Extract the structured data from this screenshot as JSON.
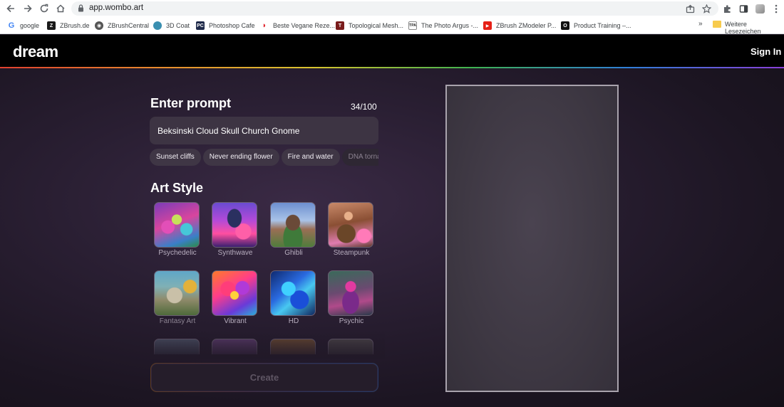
{
  "browser": {
    "url": "app.wombo.art",
    "bookmarks": [
      {
        "label": "google",
        "icon": "google-icon"
      },
      {
        "label": "ZBrush.de",
        "icon": "zbrush-de-icon"
      },
      {
        "label": "ZBrushCentral",
        "icon": "zbrushcentral-icon"
      },
      {
        "label": "3D Coat",
        "icon": "3dcoat-icon"
      },
      {
        "label": "Photoshop Cafe",
        "icon": "photoshop-cafe-icon"
      },
      {
        "label": "Beste Vegane Reze...",
        "icon": "vegan-icon"
      },
      {
        "label": "Topological Mesh...",
        "icon": "topological-icon"
      },
      {
        "label": "The Photo Argus -...",
        "icon": "photo-argus-icon"
      },
      {
        "label": "ZBrush ZModeler P...",
        "icon": "youtube-icon"
      },
      {
        "label": "Product Training –...",
        "icon": "product-training-icon"
      }
    ],
    "more_bookmarks": "»",
    "other_bookmarks": "Weitere Lesezeichen"
  },
  "app": {
    "logo": "dream",
    "sign_in": "Sign In",
    "prompt": {
      "title": "Enter prompt",
      "counter": "34/100",
      "value": "Beksinski Cloud Skull Church Gnome"
    },
    "suggestions": [
      "Sunset cliffs",
      "Never ending flower",
      "Fire and water",
      "DNA tornado"
    ],
    "art_style": {
      "title": "Art Style",
      "styles": [
        "Psychedelic",
        "Synthwave",
        "Ghibli",
        "Steampunk",
        "Fantasy Art",
        "Vibrant",
        "HD",
        "Psychic"
      ]
    },
    "create_label": "Create"
  },
  "colors": {
    "accent_gradient": [
      "#e0402f",
      "#e88a2d",
      "#d8c42e",
      "#3fb34f",
      "#2f7fd8",
      "#8a3fd8"
    ],
    "panel_bg": "#2a1f33",
    "input_bg": "#3d3443"
  }
}
